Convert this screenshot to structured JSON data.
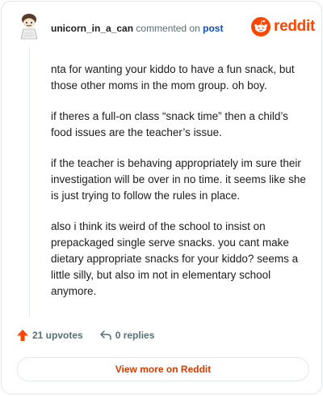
{
  "header": {
    "username": "unicorn_in_a_can",
    "action_text": "commented on",
    "post_link": "post",
    "brand": "reddit"
  },
  "comment": {
    "paragraphs": [
      "nta for wanting your kiddo to have a fun snack, but those other moms in the mom group. oh boy.",
      "if theres a full-on class “snack time” then a child’s food issues are the teacher’s issue.",
      "if the teacher is behaving appropriately im sure their investigation will be over in no time. it seems like she is just trying to follow the rules in place.",
      "also i think its weird of the school to insist on prepackaged single serve snacks. you cant make dietary appropriate snacks for your kiddo? seems a little silly, but also im not in elementary school anymore."
    ]
  },
  "actions": {
    "upvotes": "21 upvotes",
    "replies": "0 replies"
  },
  "footer": {
    "view_more": "View more on Reddit"
  },
  "colors": {
    "brand": "#ff4500",
    "link": "#0a4fc7",
    "upvote": "#ff4500"
  }
}
